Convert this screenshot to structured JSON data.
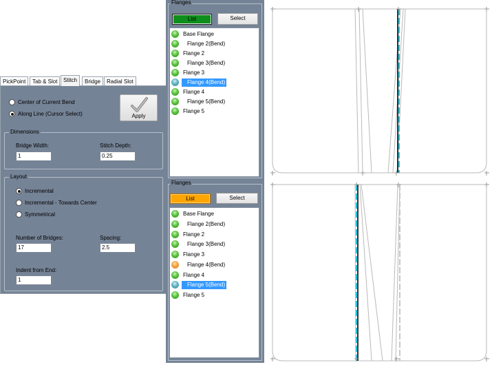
{
  "stitch_panel": {
    "tabs": [
      {
        "label": "PickPoint",
        "active": false
      },
      {
        "label": "Tab & Slot",
        "active": false
      },
      {
        "label": "Stitch",
        "active": true
      },
      {
        "label": "Bridge",
        "active": false
      },
      {
        "label": "Radial Slot",
        "active": false
      }
    ],
    "mode_options": [
      {
        "label": "Center of Current Bend",
        "checked": false
      },
      {
        "label": "Along Line (Cursor Select)",
        "checked": true
      }
    ],
    "apply_label": "Apply",
    "dimensions": {
      "title": "Dimensions",
      "bridge_width_label": "Bridge Width:",
      "bridge_width_value": "1",
      "stitch_depth_label": "Stitch Depth:",
      "stitch_depth_value": "0.25"
    },
    "layout": {
      "title": "Layout",
      "options": [
        {
          "label": "Incremental",
          "checked": true
        },
        {
          "label": "Incremental - Towards Center",
          "checked": false
        },
        {
          "label": "Symmetrical",
          "checked": false
        }
      ],
      "num_bridges_label": "Number of Bridges:",
      "num_bridges_value": "17",
      "spacing_label": "Spacing:",
      "spacing_value": "2.5",
      "indent_label": "Indent from End:",
      "indent_value": "1"
    }
  },
  "flanges_top": {
    "title": "Flanges",
    "list_label": "List",
    "select_label": "Select",
    "list_color": "#0e8f1c",
    "items": [
      {
        "label": "Base Flange",
        "dot": "green",
        "selected": false
      },
      {
        "label": "Flange 2(Bend)",
        "dot": "green",
        "selected": false
      },
      {
        "label": "Flange 2",
        "dot": "green",
        "selected": false
      },
      {
        "label": "Flange 3(Bend)",
        "dot": "green",
        "selected": false
      },
      {
        "label": "Flange 3",
        "dot": "green",
        "selected": false
      },
      {
        "label": "Flange 4(Bend)",
        "dot": "teal",
        "selected": true
      },
      {
        "label": "Flange 4",
        "dot": "green",
        "selected": false
      },
      {
        "label": "Flange 5(Bend)",
        "dot": "green",
        "selected": false
      },
      {
        "label": "Flange 5",
        "dot": "green",
        "selected": false
      }
    ]
  },
  "flanges_bottom": {
    "title": "Flanges",
    "list_label": "List",
    "select_label": "Select",
    "list_color": "#ffa500",
    "items": [
      {
        "label": "Base Flange",
        "dot": "green",
        "selected": false
      },
      {
        "label": "Flange 2(Bend)",
        "dot": "green",
        "selected": false
      },
      {
        "label": "Flange 2",
        "dot": "green",
        "selected": false
      },
      {
        "label": "Flange 3(Bend)",
        "dot": "green",
        "selected": false
      },
      {
        "label": "Flange 3",
        "dot": "green",
        "selected": false
      },
      {
        "label": "Flange 4(Bend)",
        "dot": "orange",
        "selected": false
      },
      {
        "label": "Flange 4",
        "dot": "green",
        "selected": false
      },
      {
        "label": "Flange 5(Bend)",
        "dot": "teal",
        "selected": true
      },
      {
        "label": "Flange 5",
        "dot": "green",
        "selected": false
      }
    ]
  },
  "colors": {
    "panel_bg": "#758396",
    "selection": "#3399ff",
    "highlight_cyan": "#19c6e0"
  }
}
